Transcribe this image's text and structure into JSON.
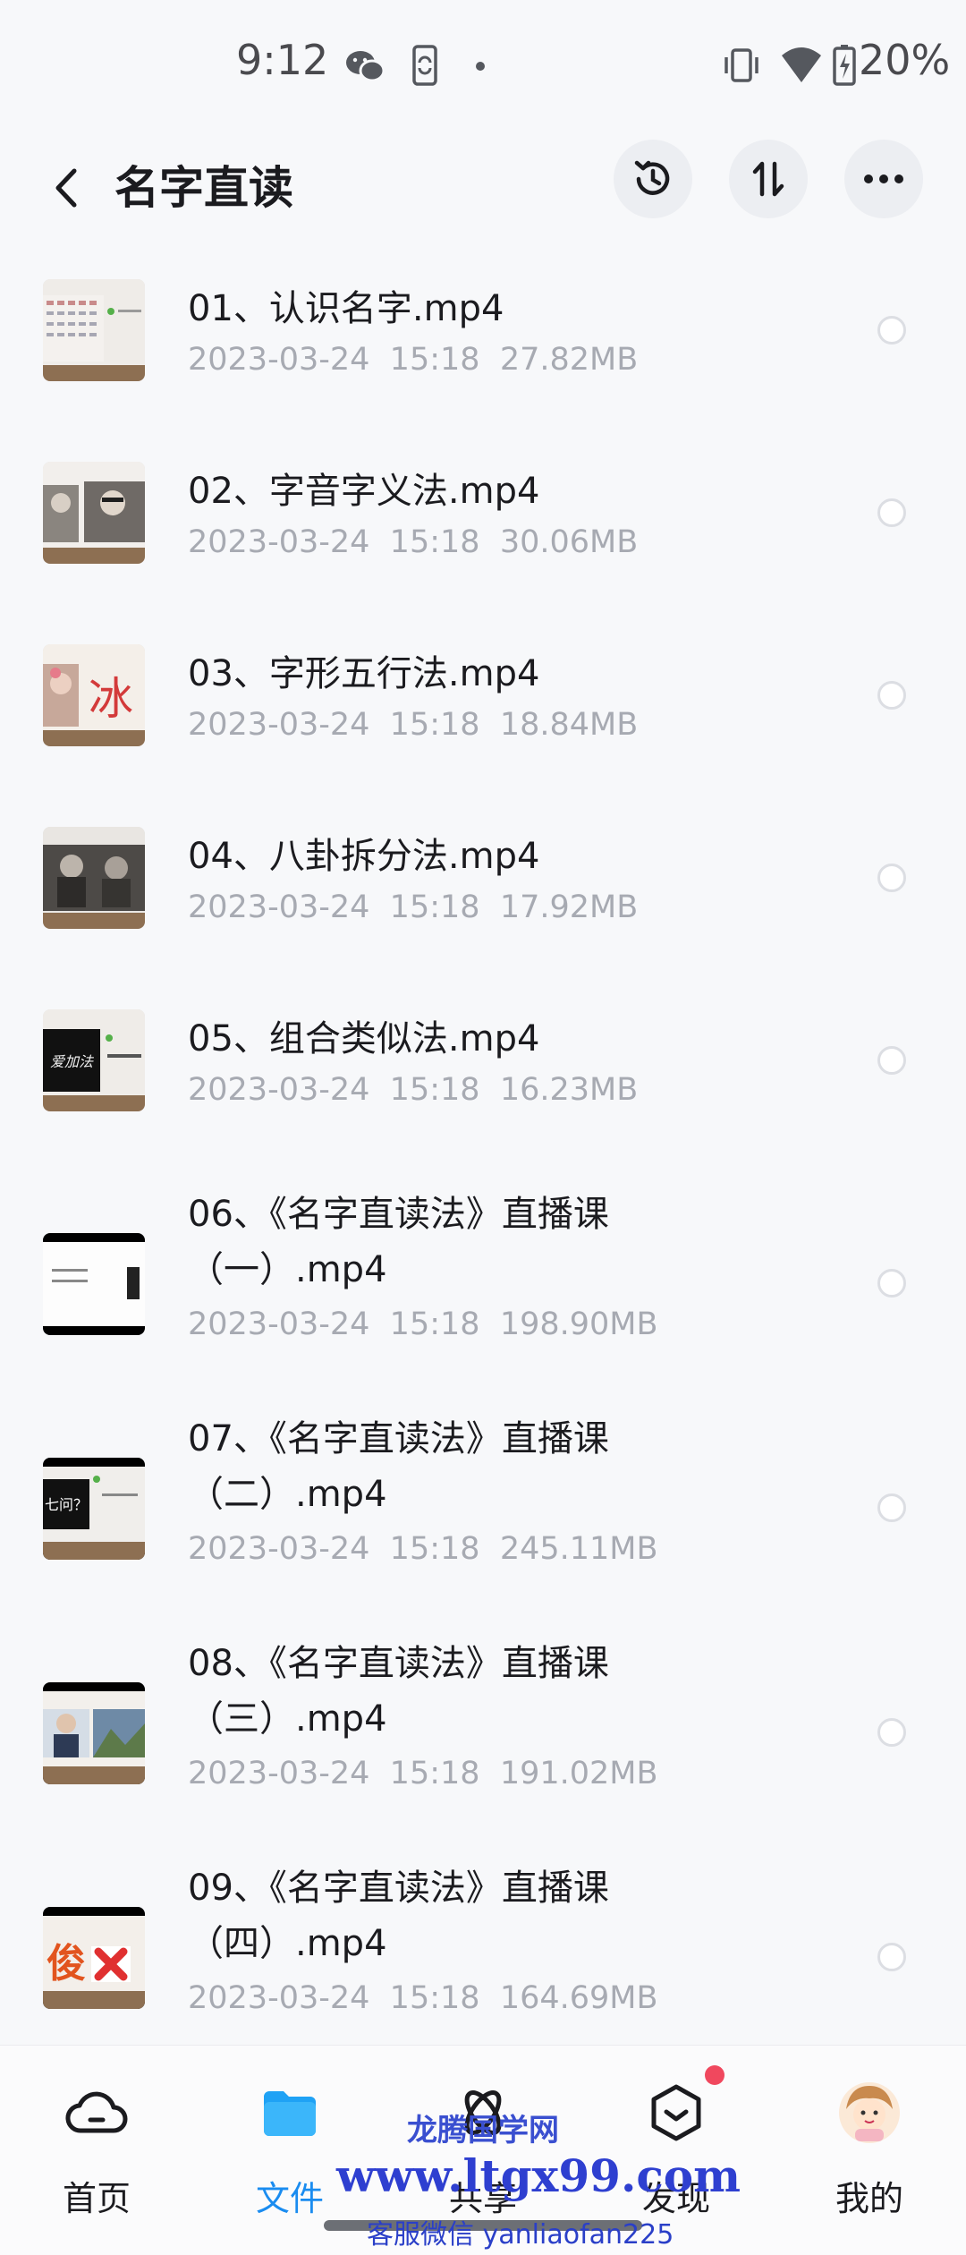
{
  "status_bar": {
    "time": "9:12",
    "icons": [
      "wechat-icon",
      "phone-sync-icon",
      "dot-icon",
      "vibrate-icon",
      "wifi-icon",
      "battery-charging-icon"
    ],
    "battery": "20%"
  },
  "header": {
    "title": "名字直读",
    "buttons": [
      "history-icon",
      "sort-icon",
      "more-icon"
    ]
  },
  "files": [
    {
      "name": "01、认识名字.mp4",
      "date": "2023-03-24",
      "time": "15:18",
      "size": "27.82MB"
    },
    {
      "name": "02、字音字义法.mp4",
      "date": "2023-03-24",
      "time": "15:18",
      "size": "30.06MB"
    },
    {
      "name": "03、字形五行法.mp4",
      "date": "2023-03-24",
      "time": "15:18",
      "size": "18.84MB"
    },
    {
      "name": "04、八卦拆分法.mp4",
      "date": "2023-03-24",
      "time": "15:18",
      "size": "17.92MB"
    },
    {
      "name": "05、组合类似法.mp4",
      "date": "2023-03-24",
      "time": "15:18",
      "size": "16.23MB"
    },
    {
      "name": "06、《名字直读法》直播课（一）.mp4",
      "date": "2023-03-24",
      "time": "15:18",
      "size": "198.90MB"
    },
    {
      "name": "07、《名字直读法》直播课（二）.mp4",
      "date": "2023-03-24",
      "time": "15:18",
      "size": "245.11MB"
    },
    {
      "name": "08、《名字直读法》直播课（三）.mp4",
      "date": "2023-03-24",
      "time": "15:18",
      "size": "191.02MB"
    },
    {
      "name": "09、《名字直读法》直播课（四）.mp4",
      "date": "2023-03-24",
      "time": "15:18",
      "size": "164.69MB"
    }
  ],
  "thumb_texts": {
    "t03": "冰",
    "t05": "爱加法",
    "t07": "七问？",
    "t09": "俊"
  },
  "bottom_nav": [
    {
      "label": "首页",
      "icon": "cloud-icon",
      "active": false
    },
    {
      "label": "文件",
      "icon": "folder-icon",
      "active": true
    },
    {
      "label": "共享",
      "icon": "share-icon",
      "active": false
    },
    {
      "label": "发现",
      "icon": "discover-icon",
      "active": false,
      "badge": true
    },
    {
      "label": "我的",
      "icon": "avatar-icon",
      "active": false
    }
  ],
  "watermark": {
    "line1": "龙腾国学网",
    "line2": "www.ltgx99.com",
    "line3": "客服微信 yanliaofan225"
  },
  "colors": {
    "accent": "#1a8cf0",
    "badge": "#f0485e",
    "meta_text": "#a7aab2",
    "watermark": "#2e3fd0"
  }
}
